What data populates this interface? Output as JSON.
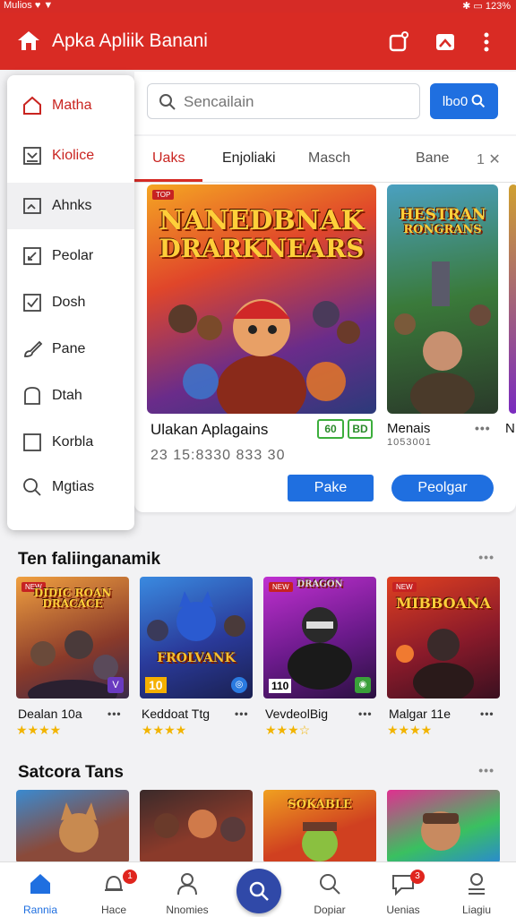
{
  "status": {
    "left": "Mulios ♥ ▼",
    "right": "✱ ▭ 123%"
  },
  "appbar": {
    "title": "Apka Apliik Banani"
  },
  "search": {
    "placeholder": "Sencailain",
    "button_label": "lbo0"
  },
  "tabs": [
    {
      "label": "Uaks"
    },
    {
      "label": "Enjoliaki"
    },
    {
      "label": "Masch"
    },
    {
      "label": "Bane"
    }
  ],
  "tabs_close": "1 ✕",
  "drawer": {
    "items": [
      {
        "label": "Matha",
        "icon": "home-icon"
      },
      {
        "label": "Kiolice",
        "icon": "inbox-icon"
      },
      {
        "label": "Ahnks",
        "icon": "image-icon"
      },
      {
        "label": "Peolar",
        "icon": "edit-icon"
      },
      {
        "label": "Dosh",
        "icon": "checkbox-icon"
      },
      {
        "label": "Pane",
        "icon": "brush-icon"
      },
      {
        "label": "Dtah",
        "icon": "door-icon"
      },
      {
        "label": "Korbla",
        "icon": "square-icon"
      },
      {
        "label": "Mgtias",
        "icon": "search-icon"
      }
    ]
  },
  "featured": {
    "main": {
      "art_title_1": "NANEDBNAK",
      "art_title_2": "DRARKNEARS",
      "badge": "TOP",
      "name": "Ulakan Aplagains",
      "sub": "23 15:8330 833 30",
      "pill_1": "60",
      "pill_2": "BD",
      "button": "Pake"
    },
    "second": {
      "art_title_1": "HESTRAN",
      "art_title_2": "RONGRANS",
      "name": "Menais",
      "sub": "1053001",
      "button": "Peolgar"
    },
    "third_name": "N"
  },
  "section1": {
    "title": "Ten faliinganamik",
    "items": [
      {
        "art": "DIDIC ROAN DRACACE",
        "badge": "NEW",
        "name": "Dealan 10a",
        "stars": "★★★★",
        "corner": "V"
      },
      {
        "art": "FROLVANK",
        "badge": "10",
        "name": "Keddoat Ttg",
        "stars": "★★★★",
        "corner": "◎"
      },
      {
        "art": "DRAGON",
        "badge": "NEW",
        "name": "VevdeolBig",
        "stars": "★★★☆",
        "corner": "◉"
      },
      {
        "art": "MIBBOANA",
        "badge": "NEW",
        "name": "Malgar 11e",
        "stars": "★★★★",
        "corner": ""
      }
    ],
    "corner_badge": "110"
  },
  "section2": {
    "title": "Satcora Tans",
    "items": [
      {
        "art": ""
      },
      {
        "art": ""
      },
      {
        "art": "SOKABLE"
      },
      {
        "art": ""
      }
    ]
  },
  "bottomnav": [
    {
      "label": "Rannia",
      "icon": "home-icon",
      "badge": ""
    },
    {
      "label": "Hace",
      "icon": "bell-icon",
      "badge": "1"
    },
    {
      "label": "Nnomies",
      "icon": "person-icon",
      "badge": ""
    },
    {
      "label": "Dopiar",
      "icon": "search-icon",
      "badge": ""
    },
    {
      "label": "Uenias",
      "icon": "chat-icon",
      "badge": "3"
    },
    {
      "label": "Liagiu",
      "icon": "profile-icon",
      "badge": ""
    }
  ],
  "colors": {
    "brand": "#d92b24",
    "accent": "#1f6fe0",
    "fab": "#3049a8"
  }
}
